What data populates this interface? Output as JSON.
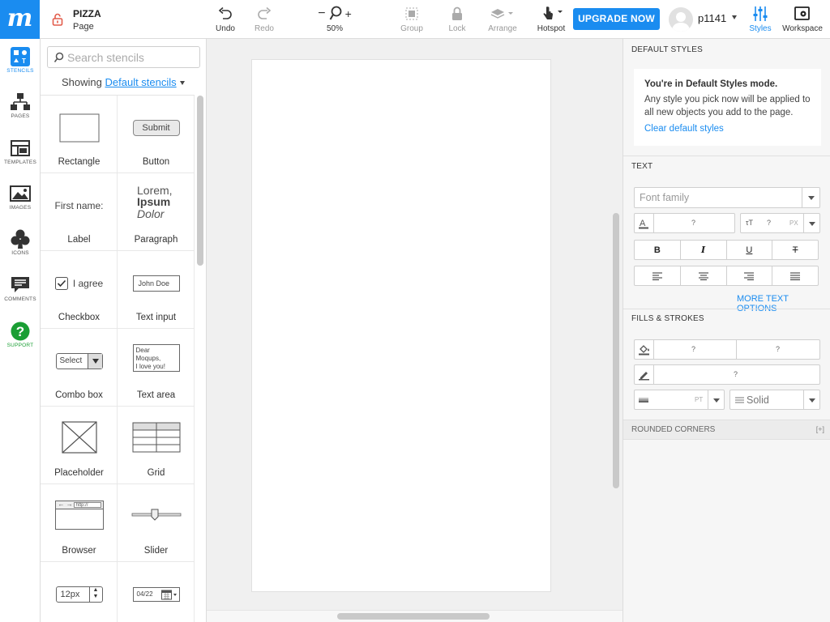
{
  "app": {
    "logo_letter": "m",
    "accent": "#1a8cf0",
    "support_color": "#1a9e34"
  },
  "header": {
    "project_name": "PIZZA",
    "page_name": "Page",
    "undo_label": "Undo",
    "redo_label": "Redo",
    "zoom_minus": "−",
    "zoom_plus": "+",
    "zoom_level": "50%",
    "group_label": "Group",
    "lock_label": "Lock",
    "arrange_label": "Arrange",
    "hotspot_label": "Hotspot",
    "upgrade_label": "UPGRADE NOW",
    "username": "p1141",
    "styles_label": "Styles",
    "workspace_label": "Workspace"
  },
  "leftnav": [
    {
      "label": "STENCILS",
      "icon": "stencils-icon"
    },
    {
      "label": "PAGES",
      "icon": "pages-icon"
    },
    {
      "label": "TEMPLATES",
      "icon": "templates-icon"
    },
    {
      "label": "IMAGES",
      "icon": "images-icon"
    },
    {
      "label": "ICONS",
      "icon": "club-icon"
    },
    {
      "label": "COMMENTS",
      "icon": "comments-icon"
    },
    {
      "label": "SUPPORT",
      "icon": "help-icon"
    }
  ],
  "stencils": {
    "search_placeholder": "Search stencils",
    "showing_prefix": "Showing",
    "showing_link": "Default stencils",
    "items": [
      {
        "label": "Rectangle"
      },
      {
        "label": "Button",
        "preview_text": "Submit"
      },
      {
        "label": "Label",
        "preview_text": "First name:"
      },
      {
        "label": "Paragraph",
        "preview_line1": "Lorem,",
        "preview_line2": "Ipsum",
        "preview_line3": "Dolor"
      },
      {
        "label": "Checkbox",
        "preview_text": "I agree"
      },
      {
        "label": "Text input",
        "preview_text": "John Doe"
      },
      {
        "label": "Combo box",
        "preview_text": "Select"
      },
      {
        "label": "Text area",
        "preview_line1": "Dear Moqups,",
        "preview_line2": "I love you!"
      },
      {
        "label": "Placeholder"
      },
      {
        "label": "Grid"
      },
      {
        "label": "Browser",
        "preview_text": "http://"
      },
      {
        "label": "Slider"
      },
      {
        "label": "",
        "preview_text": "12px"
      },
      {
        "label": "",
        "preview_text": "04/22"
      }
    ]
  },
  "styles_panel": {
    "default_styles_title": "DEFAULT STYLES",
    "mode_title": "You're in Default Styles mode.",
    "mode_desc": "Any style you pick now will be applied to all new objects you add to the page.",
    "clear_link": "Clear default styles",
    "text_title": "TEXT",
    "font_family_placeholder": "Font family",
    "font_color_value": "?",
    "font_size_value": "?",
    "font_size_unit": "PX",
    "bold": "B",
    "italic": "I",
    "underline": "U",
    "strike": "T",
    "more_text_options": "MORE TEXT OPTIONS",
    "fills_title": "FILLS & STROKES",
    "fill_value_1": "?",
    "fill_value_2": "?",
    "stroke_value": "?",
    "stroke_width_unit": "PT",
    "stroke_style": "Solid",
    "rounded_title": "ROUNDED CORNERS",
    "rounded_toggle": "[+]"
  }
}
